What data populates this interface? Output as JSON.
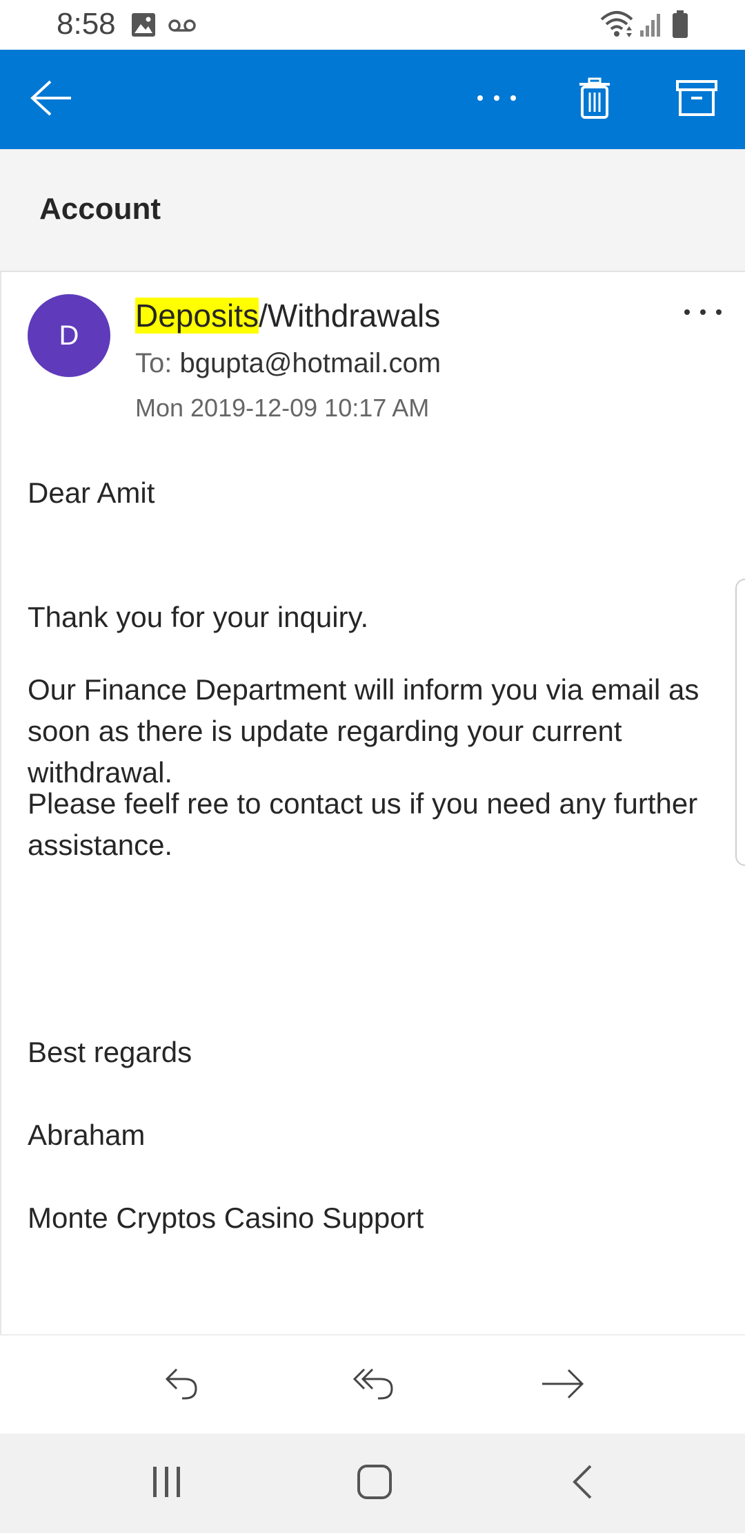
{
  "status_bar": {
    "time": "8:58",
    "icons": [
      "image-icon",
      "voicemail-icon",
      "wifi-icon",
      "signal-icon",
      "battery-icon"
    ]
  },
  "app_bar": {
    "color": "#0078d4",
    "back_icon": "arrow-left-icon",
    "actions": [
      "more-icon",
      "trash-icon",
      "archive-icon"
    ]
  },
  "folder": {
    "title": "Account"
  },
  "message": {
    "avatar_initial": "D",
    "avatar_color": "#5f3bbb",
    "subject_highlight": "Deposits",
    "subject_rest": "/Withdrawals",
    "to_label": "To:",
    "to_address": "bgupta@hotmail.com",
    "date": "Mon 2019-12-09 10:17 AM",
    "body": {
      "greeting": "Dear Amit",
      "p1": "Thank you for your inquiry.",
      "p2": "Our Finance Department will inform you via email as soon as there is update regarding your current withdrawal.",
      "p3": "Please feelf ree to contact us if you need any further assistance.",
      "closing": "Best regards",
      "name": "Abraham",
      "company": "Monte Cryptos Casino Support"
    }
  },
  "actions": [
    "reply-icon",
    "reply-all-icon",
    "forward-icon"
  ],
  "nav": [
    "recent-apps-icon",
    "home-icon",
    "back-icon"
  ]
}
